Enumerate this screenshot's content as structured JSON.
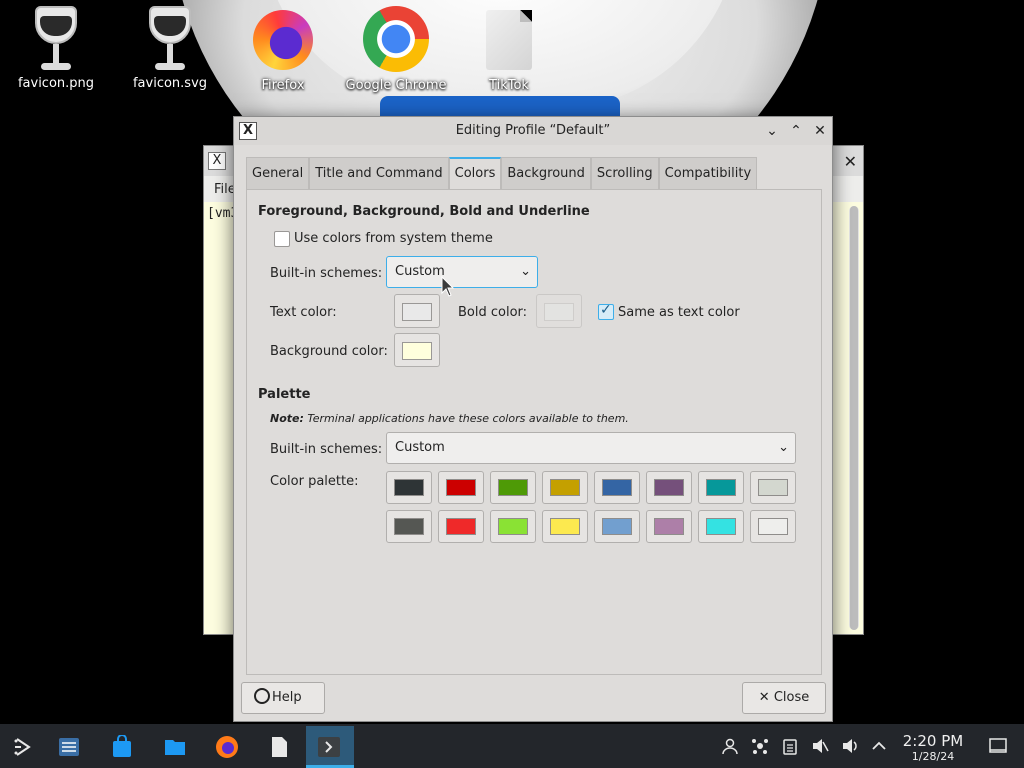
{
  "desktop": {
    "icons": [
      {
        "label": "favicon.png",
        "icon": "wine-glass-icon"
      },
      {
        "label": "favicon.svg",
        "icon": "wine-glass-icon"
      },
      {
        "label": "Firefox",
        "icon": "firefox-icon"
      },
      {
        "label": "Google Chrome",
        "icon": "chrome-icon"
      },
      {
        "label": "TikTok",
        "icon": "document-icon"
      }
    ]
  },
  "background_window": {
    "menu_text": "File",
    "terminal_text": "[vm3"
  },
  "dialog": {
    "title": "Editing Profile “Default”",
    "tabs": [
      {
        "label": "General",
        "active": false
      },
      {
        "label": "Title and Command",
        "active": false
      },
      {
        "label": "Colors",
        "active": true
      },
      {
        "label": "Background",
        "active": false
      },
      {
        "label": "Scrolling",
        "active": false
      },
      {
        "label": "Compatibility",
        "active": false
      }
    ],
    "fg_section": {
      "title": "Foreground, Background, Bold and Underline",
      "use_system_theme_label": "Use colors from system theme",
      "use_system_theme_checked": false,
      "builtin_schemes_label": "Built-in schemes:",
      "builtin_schemes_value": "Custom",
      "text_color_label": "Text color:",
      "text_color": "#e9e9e9",
      "bold_color_label": "Bold color:",
      "bold_color": "#e3e3e1",
      "same_as_text_label": "Same as text color",
      "same_as_text_checked": true,
      "background_color_label": "Background color:",
      "background_color": "#ffffdd"
    },
    "palette_section": {
      "title": "Palette",
      "note_bold": "Note:",
      "note_text": "Terminal applications have these colors available to them.",
      "builtin_schemes_label": "Built-in schemes:",
      "builtin_schemes_value": "Custom",
      "color_palette_label": "Color palette:",
      "colors_row1": [
        "#2e3436",
        "#cc0000",
        "#4e9a06",
        "#c4a000",
        "#3465a4",
        "#75507b",
        "#06989a",
        "#d3d7cf"
      ],
      "colors_row2": [
        "#555753",
        "#ef2929",
        "#8ae234",
        "#fce94f",
        "#729fcf",
        "#ad7fa8",
        "#34e2e2",
        "#eeeeec"
      ]
    },
    "help_label": "Help",
    "close_label": "Close"
  },
  "taskbar": {
    "items": [
      "app-launcher-icon",
      "system-settings-icon",
      "discover-store-icon",
      "file-manager-icon",
      "firefox-icon",
      "text-editor-icon",
      "konsole-icon"
    ],
    "active_item": "konsole-icon",
    "tray": [
      "user-icon",
      "network-icon",
      "clipboard-icon",
      "mute-icon",
      "volume-icon",
      "expand-tray-icon"
    ],
    "time": "2:20 PM",
    "date": "1/28/24"
  },
  "accent_color": "#3daee9"
}
